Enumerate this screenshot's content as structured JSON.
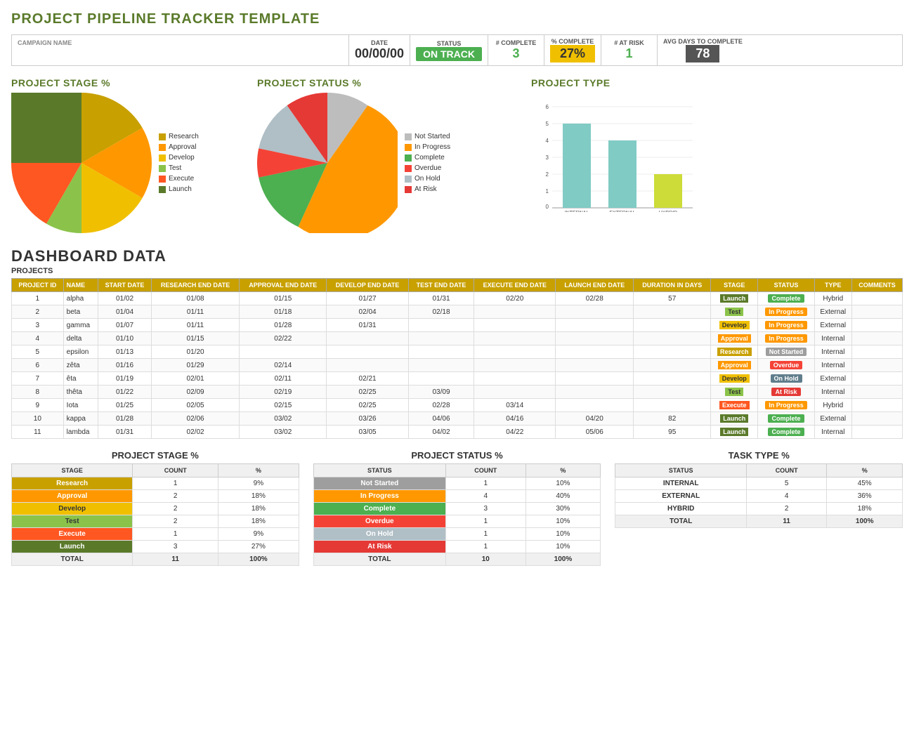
{
  "title": "PROJECT PIPELINE TRACKER TEMPLATE",
  "header": {
    "campaign_label": "CAMPAIGN NAME",
    "date_label": "DATE",
    "status_label": "STATUS",
    "complete_label": "# COMPLETE",
    "pct_complete_label": "% COMPLETE",
    "at_risk_label": "# AT RISK",
    "avg_days_label": "AVG DAYS TO COMPLETE",
    "date_value": "00/00/00",
    "status_value": "ON TRACK",
    "complete_value": "3",
    "pct_complete_value": "27%",
    "at_risk_value": "1",
    "avg_days_value": "78"
  },
  "stage_chart_title": "PROJECT STAGE %",
  "status_chart_title": "PROJECT STATUS %",
  "type_chart_title": "PROJECT TYPE",
  "dashboard_title": "DASHBOARD DATA",
  "projects_label": "PROJECTS",
  "table_headers": {
    "id": "PROJECT ID",
    "name": "NAME",
    "start": "START DATE",
    "research_end": "RESEARCH END DATE",
    "approval_end": "APPROVAL END DATE",
    "develop_end": "DEVELOP END DATE",
    "test_end": "TEST END DATE",
    "execute_end": "EXECUTE END DATE",
    "launch_end": "LAUNCH END DATE",
    "duration": "DURATION in days",
    "stage": "STAGE",
    "status": "STATUS",
    "type": "TYPE",
    "comments": "COMMENTS"
  },
  "projects": [
    {
      "id": 1,
      "name": "alpha",
      "start": "01/02",
      "research": "01/08",
      "approval": "01/15",
      "develop": "01/27",
      "test": "01/31",
      "execute": "02/20",
      "launch": "02/28",
      "duration": 57,
      "stage": "Launch",
      "status": "Complete",
      "type": "Hybrid"
    },
    {
      "id": 2,
      "name": "beta",
      "start": "01/04",
      "research": "01/11",
      "approval": "01/18",
      "develop": "02/04",
      "test": "02/18",
      "execute": "",
      "launch": "",
      "duration": "",
      "stage": "Test",
      "status": "In Progress",
      "type": "External"
    },
    {
      "id": 3,
      "name": "gamma",
      "start": "01/07",
      "research": "01/11",
      "approval": "01/28",
      "develop": "01/31",
      "test": "",
      "execute": "",
      "launch": "",
      "duration": "",
      "stage": "Develop",
      "status": "In Progress",
      "type": "External"
    },
    {
      "id": 4,
      "name": "delta",
      "start": "01/10",
      "research": "01/15",
      "approval": "02/22",
      "develop": "",
      "test": "",
      "execute": "",
      "launch": "",
      "duration": "",
      "stage": "Approval",
      "status": "In Progress",
      "type": "Internal"
    },
    {
      "id": 5,
      "name": "epsilon",
      "start": "01/13",
      "research": "01/20",
      "approval": "",
      "develop": "",
      "test": "",
      "execute": "",
      "launch": "",
      "duration": "",
      "stage": "Research",
      "status": "Not Started",
      "type": "Internal"
    },
    {
      "id": 6,
      "name": "zêta",
      "start": "01/16",
      "research": "01/29",
      "approval": "02/14",
      "develop": "",
      "test": "",
      "execute": "",
      "launch": "",
      "duration": "",
      "stage": "Approval",
      "status": "Overdue",
      "type": "Internal"
    },
    {
      "id": 7,
      "name": "êta",
      "start": "01/19",
      "research": "02/01",
      "approval": "02/11",
      "develop": "02/21",
      "test": "",
      "execute": "",
      "launch": "",
      "duration": "",
      "stage": "Develop",
      "status": "On Hold",
      "type": "External"
    },
    {
      "id": 8,
      "name": "thêta",
      "start": "01/22",
      "research": "02/09",
      "approval": "02/19",
      "develop": "02/25",
      "test": "03/09",
      "execute": "",
      "launch": "",
      "duration": "",
      "stage": "Test",
      "status": "At Risk",
      "type": "Internal"
    },
    {
      "id": 9,
      "name": "Iota",
      "start": "01/25",
      "research": "02/05",
      "approval": "02/15",
      "develop": "02/25",
      "test": "02/28",
      "execute": "03/14",
      "launch": "",
      "duration": "",
      "stage": "Execute",
      "status": "In Progress",
      "type": "Hybrid"
    },
    {
      "id": 10,
      "name": "kappa",
      "start": "01/28",
      "research": "02/06",
      "approval": "03/02",
      "develop": "03/26",
      "test": "04/06",
      "execute": "04/16",
      "launch": "04/20",
      "duration": 82,
      "stage": "Launch",
      "status": "Complete",
      "type": "External"
    },
    {
      "id": 11,
      "name": "lambda",
      "start": "01/31",
      "research": "02/02",
      "approval": "03/02",
      "develop": "03/05",
      "test": "04/02",
      "execute": "04/22",
      "launch": "05/06",
      "duration": 95,
      "stage": "Launch",
      "status": "Complete",
      "type": "Internal"
    }
  ],
  "stage_summary": {
    "title": "PROJECT STAGE %",
    "headers": [
      "STAGE",
      "COUNT",
      "%"
    ],
    "rows": [
      {
        "stage": "Research",
        "count": 1,
        "pct": "9%",
        "color": "research"
      },
      {
        "stage": "Approval",
        "count": 2,
        "pct": "18%",
        "color": "approval"
      },
      {
        "stage": "Develop",
        "count": 2,
        "pct": "18%",
        "color": "develop"
      },
      {
        "stage": "Test",
        "count": 2,
        "pct": "18%",
        "color": "test"
      },
      {
        "stage": "Execute",
        "count": 1,
        "pct": "9%",
        "color": "execute"
      },
      {
        "stage": "Launch",
        "count": 3,
        "pct": "27%",
        "color": "launch"
      }
    ],
    "total_count": 11,
    "total_pct": "100%"
  },
  "status_summary": {
    "title": "PROJECT STATUS %",
    "headers": [
      "STATUS",
      "COUNT",
      "%"
    ],
    "rows": [
      {
        "status": "Not Started",
        "count": 1,
        "pct": "10%",
        "color": "ns"
      },
      {
        "status": "In Progress",
        "count": 4,
        "pct": "40%",
        "color": "ip"
      },
      {
        "status": "Complete",
        "count": 3,
        "pct": "30%",
        "color": "cp"
      },
      {
        "status": "Overdue",
        "count": 1,
        "pct": "10%",
        "color": "ov"
      },
      {
        "status": "On Hold",
        "count": 1,
        "pct": "10%",
        "color": "oh"
      },
      {
        "status": "At Risk",
        "count": 1,
        "pct": "10%",
        "color": "ar"
      }
    ],
    "total_count": 10,
    "total_pct": "100%"
  },
  "type_summary": {
    "title": "TASK TYPE %",
    "headers": [
      "STATUS",
      "COUNT",
      "%"
    ],
    "rows": [
      {
        "status": "INTERNAL",
        "count": 5,
        "pct": "45%"
      },
      {
        "status": "EXTERNAL",
        "count": 4,
        "pct": "36%"
      },
      {
        "status": "HYBRID",
        "count": 2,
        "pct": "18%"
      }
    ],
    "total_count": 11,
    "total_pct": "100%"
  },
  "stage_legend": [
    {
      "label": "Research",
      "color": "#c8a000"
    },
    {
      "label": "Approval",
      "color": "#ff9800"
    },
    {
      "label": "Develop",
      "color": "#f0c000"
    },
    {
      "label": "Test",
      "color": "#8bc34a"
    },
    {
      "label": "Execute",
      "color": "#ff5722"
    },
    {
      "label": "Launch",
      "color": "#5a7a2a"
    }
  ],
  "status_legend": [
    {
      "label": "Not Started",
      "color": "#bdbdbd"
    },
    {
      "label": "In Progress",
      "color": "#ff9800"
    },
    {
      "label": "Complete",
      "color": "#4caf50"
    },
    {
      "label": "Overdue",
      "color": "#f44336"
    },
    {
      "label": "On Hold",
      "color": "#b0bec5"
    },
    {
      "label": "At Risk",
      "color": "#e53935"
    }
  ],
  "bar_chart_labels": [
    "INTERNAL",
    "EXTERNAL",
    "HYBRID"
  ],
  "bar_chart_values": [
    5,
    4,
    2
  ]
}
